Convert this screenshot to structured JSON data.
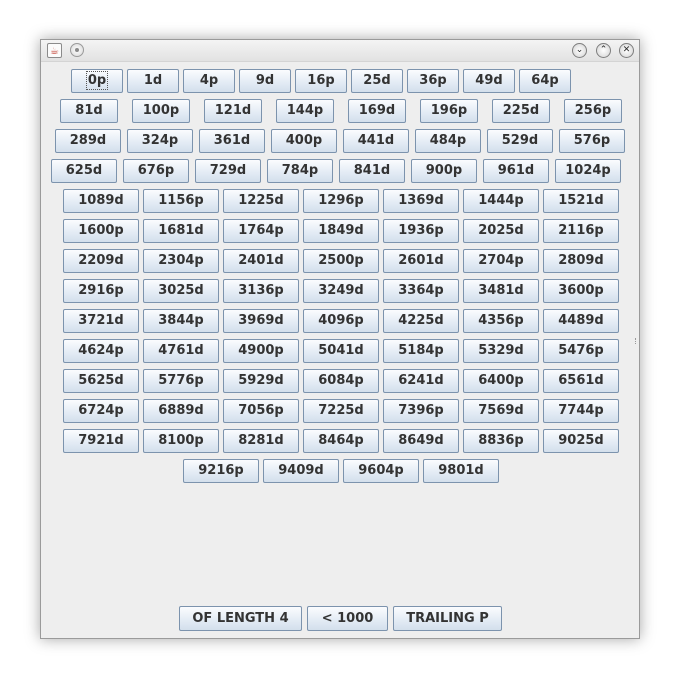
{
  "window": {
    "controls": {
      "minimize_glyph": "⌄",
      "maximize_glyph": "⌃",
      "close_glyph": "✕"
    },
    "icons": [
      "java-icon",
      "window-menu-icon",
      "minimize-icon",
      "maximize-icon",
      "close-icon"
    ]
  },
  "number_buttons": [
    [
      "0p",
      "1d",
      "4p",
      "9d",
      "16p",
      "25d",
      "36p",
      "49d",
      "64p"
    ],
    [
      "81d",
      "100p",
      "121d",
      "144p",
      "169d",
      "196p",
      "225d",
      "256p"
    ],
    [
      "289d",
      "324p",
      "361d",
      "400p",
      "441d",
      "484p",
      "529d",
      "576p"
    ],
    [
      "625d",
      "676p",
      "729d",
      "784p",
      "841d",
      "900p",
      "961d",
      "1024p"
    ],
    [
      "1089d",
      "1156p",
      "1225d",
      "1296p",
      "1369d",
      "1444p",
      "1521d"
    ],
    [
      "1600p",
      "1681d",
      "1764p",
      "1849d",
      "1936p",
      "2025d",
      "2116p"
    ],
    [
      "2209d",
      "2304p",
      "2401d",
      "2500p",
      "2601d",
      "2704p",
      "2809d"
    ],
    [
      "2916p",
      "3025d",
      "3136p",
      "3249d",
      "3364p",
      "3481d",
      "3600p"
    ],
    [
      "3721d",
      "3844p",
      "3969d",
      "4096p",
      "4225d",
      "4356p",
      "4489d"
    ],
    [
      "4624p",
      "4761d",
      "4900p",
      "5041d",
      "5184p",
      "5329d",
      "5476p"
    ],
    [
      "5625d",
      "5776p",
      "5929d",
      "6084p",
      "6241d",
      "6400p",
      "6561d"
    ],
    [
      "6724p",
      "6889d",
      "7056p",
      "7225d",
      "7396p",
      "7569d",
      "7744p"
    ],
    [
      "7921d",
      "8100p",
      "8281d",
      "8464p",
      "8649d",
      "8836p",
      "9025d"
    ],
    [
      "9216p",
      "9409d",
      "9604p",
      "9801d"
    ]
  ],
  "filter_buttons": [
    "OF LENGTH 4",
    "< 1000",
    "TRAILING P"
  ]
}
